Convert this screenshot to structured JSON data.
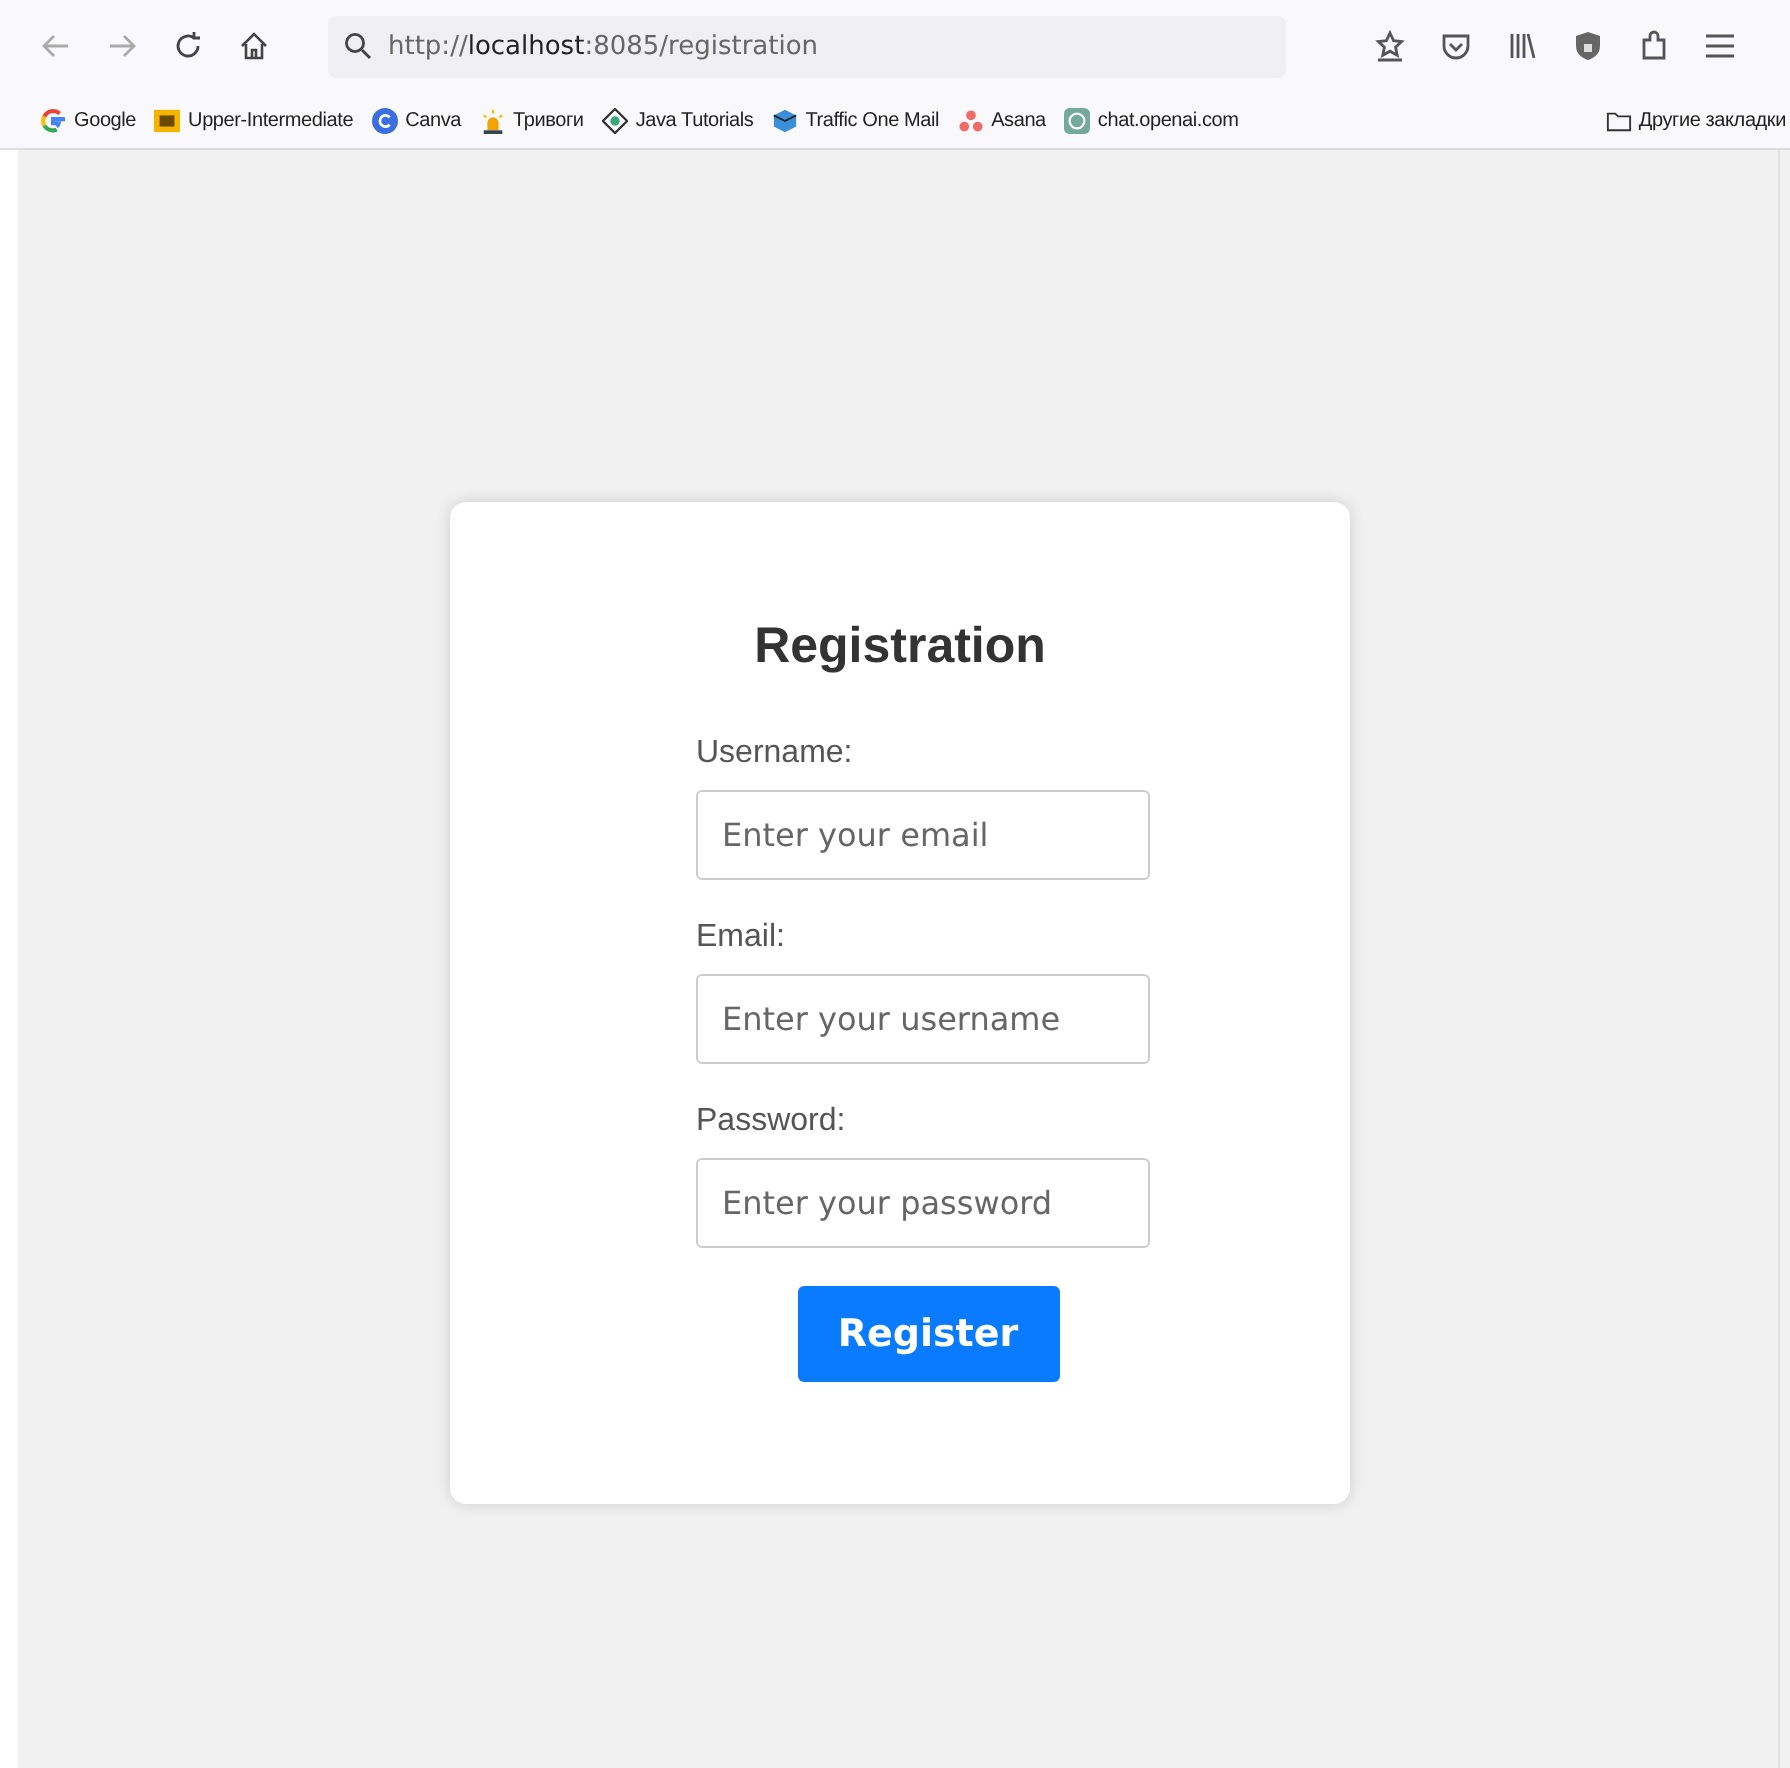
{
  "browser": {
    "url": "http://**localhost**:8085/registration",
    "bookmarks": [
      {
        "label": "Google"
      },
      {
        "label": "Upper-Intermediate"
      },
      {
        "label": "Canva"
      },
      {
        "label": "Тривоги"
      },
      {
        "label": "Java Tutorials"
      },
      {
        "label": "Traffic One Mail"
      },
      {
        "label": "Asana"
      },
      {
        "label": "chat.openai.com"
      }
    ],
    "other_bookmarks": "Другие закладки"
  },
  "form": {
    "title": "Registration",
    "fields": [
      {
        "label": "Username:",
        "placeholder": "Enter your email"
      },
      {
        "label": "Email:",
        "placeholder": "Enter your username"
      },
      {
        "label": "Password:",
        "placeholder": "Enter your password"
      }
    ],
    "submit": "Register"
  }
}
